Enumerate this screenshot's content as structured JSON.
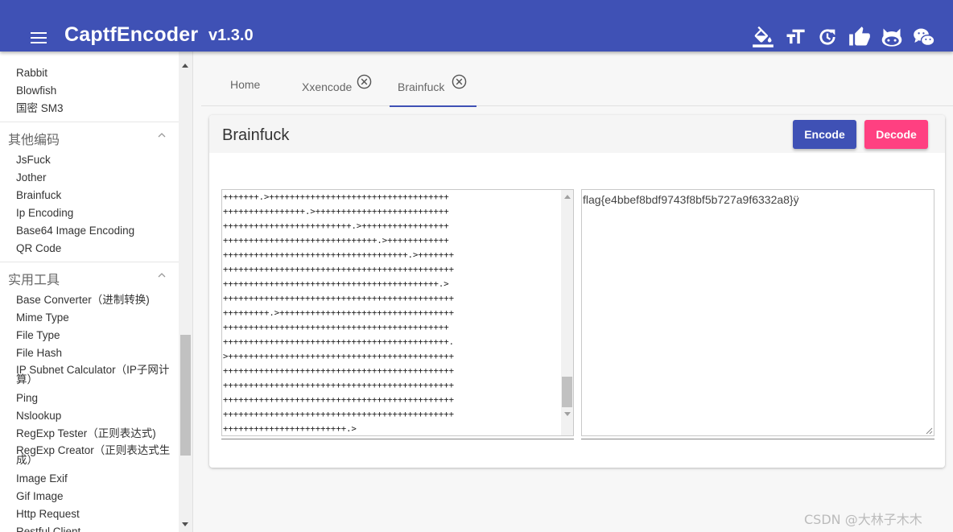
{
  "app": {
    "title": "CaptfEncoder",
    "version": "v1.3.0",
    "accent": "#3f51b5",
    "secondary": "#ff4081"
  },
  "toolbar": {
    "icons": [
      "paint-bucket-icon",
      "text-size-icon",
      "refresh-icon",
      "thumbs-up-icon",
      "github-icon",
      "wechat-icon"
    ]
  },
  "sidebar": {
    "items_top": [
      "Rabbit",
      "Blowfish",
      "国密 SM3"
    ],
    "section_other": {
      "label": "其他编码",
      "items": [
        "JsFuck",
        "Jother",
        "Brainfuck",
        "Ip Encoding",
        "Base64 Image Encoding",
        "QR Code"
      ]
    },
    "section_tools": {
      "label": "实用工具",
      "items": [
        "Base Converter（进制转换)",
        "Mime Type",
        "File Type",
        "File Hash",
        "IP Subnet Calculator（IP子网计算）",
        "Ping",
        "Nslookup",
        "RegExp Tester（正则表达式)",
        "RegExp Creator（正则表达式生成）",
        "Image Exif",
        "Gif Image",
        "Http Request",
        "Restful Client"
      ]
    }
  },
  "tabs": [
    {
      "label": "Home",
      "closable": false
    },
    {
      "label": "Xxencode",
      "closable": true
    },
    {
      "label": "Brainfuck",
      "closable": true,
      "active": true
    }
  ],
  "panel": {
    "title": "Brainfuck",
    "encode_label": "Encode",
    "decode_label": "Decode",
    "input_lines": [
      "+++++++.>+++++++++++++++++++++++++++++++++++",
      "++++++++++++++++.>++++++++++++++++++++++++++",
      "+++++++++++++++++++++++++.>+++++++++++++++++",
      "++++++++++++++++++++++++++++++.>++++++++++++",
      "++++++++++++++++++++++++++++++++++++.>+++++++",
      "+++++++++++++++++++++++++++++++++++++++++++++",
      "++++++++++++++++++++++++++++++++++++++++++.>",
      "+++++++++++++++++++++++++++++++++++++++++++++",
      "+++++++++.>++++++++++++++++++++++++++++++++++",
      "++++++++++++++++++++++++++++++++++++++++++++",
      "++++++++++++++++++++++++++++++++++++++++++++.",
      ">++++++++++++++++++++++++++++++++++++++++++++",
      "+++++++++++++++++++++++++++++++++++++++++++++",
      "+++++++++++++++++++++++++++++++++++++++++++++",
      "+++++++++++++++++++++++++++++++++++++++++++++",
      "+++++++++++++++++++++++++++++++++++++++++++++",
      "++++++++++++++++++++++++.>"
    ],
    "output_text": "flag{e4bbef8bdf9743f8bf5b727a9f6332a8}ÿ"
  },
  "watermark": "CSDN @大林子木木"
}
